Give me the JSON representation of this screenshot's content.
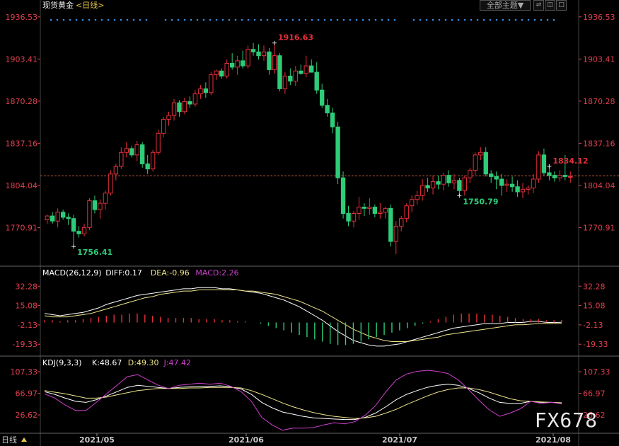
{
  "header": {
    "instrument": "现货黄金",
    "period_label": "<日线>"
  },
  "toolbar": {
    "theme_label": "全部主题",
    "theme_arrow": "▼",
    "btn_a": "⇌",
    "btn_b": "◫",
    "btn_c": "□"
  },
  "watermark": "FX678",
  "bottom_tag": "日线",
  "colors": {
    "up": "#e8303a",
    "down": "#2ecc78",
    "axis": "#e04050",
    "grid": "#444444",
    "ref": "#c0603c",
    "yellow": "#f0e68c",
    "white": "#ffffff",
    "magenta": "#d040d0",
    "dot": "#3a8ee6"
  },
  "chart_data": [
    {
      "type": "candlestick",
      "title": "现货黄金<日线>",
      "x_labels": [
        "2021/05",
        "2021/06",
        "2021/07",
        "2021/08"
      ],
      "y_ticks": [
        1936.53,
        1903.41,
        1870.28,
        1837.16,
        1804.04,
        1770.91
      ],
      "ylim": [
        1745,
        1942
      ],
      "last_price": 1811.5,
      "annotations": [
        {
          "label": "1756.41",
          "index": 5,
          "kind": "low"
        },
        {
          "label": "1916.63",
          "index": 43,
          "kind": "high"
        },
        {
          "label": "1750.79",
          "index": 78,
          "kind": "low"
        },
        {
          "label": "1834.12",
          "index": 95,
          "kind": "high"
        }
      ],
      "candles": [
        [
          1777,
          1781,
          1774,
          1780
        ],
        [
          1780,
          1783,
          1774,
          1776
        ],
        [
          1776,
          1786,
          1771,
          1783
        ],
        [
          1783,
          1785,
          1777,
          1779
        ],
        [
          1779,
          1782,
          1773,
          1778
        ],
        [
          1778,
          1781,
          1756,
          1768
        ],
        [
          1768,
          1772,
          1763,
          1766
        ],
        [
          1766,
          1774,
          1764,
          1771
        ],
        [
          1771,
          1794,
          1769,
          1792
        ],
        [
          1792,
          1796,
          1782,
          1785
        ],
        [
          1785,
          1793,
          1778,
          1790
        ],
        [
          1790,
          1800,
          1785,
          1798
        ],
        [
          1798,
          1816,
          1796,
          1813
        ],
        [
          1813,
          1821,
          1808,
          1819
        ],
        [
          1819,
          1834,
          1817,
          1830
        ],
        [
          1830,
          1838,
          1826,
          1833
        ],
        [
          1833,
          1835,
          1826,
          1828
        ],
        [
          1828,
          1839,
          1823,
          1836
        ],
        [
          1836,
          1838,
          1818,
          1821
        ],
        [
          1821,
          1828,
          1813,
          1817
        ],
        [
          1817,
          1832,
          1815,
          1830
        ],
        [
          1830,
          1848,
          1828,
          1845
        ],
        [
          1845,
          1858,
          1842,
          1856
        ],
        [
          1856,
          1862,
          1851,
          1859
        ],
        [
          1859,
          1872,
          1855,
          1869
        ],
        [
          1869,
          1871,
          1858,
          1862
        ],
        [
          1862,
          1873,
          1860,
          1870
        ],
        [
          1870,
          1874,
          1865,
          1868
        ],
        [
          1868,
          1879,
          1866,
          1876
        ],
        [
          1876,
          1883,
          1872,
          1880
        ],
        [
          1880,
          1885,
          1873,
          1877
        ],
        [
          1877,
          1893,
          1875,
          1891
        ],
        [
          1891,
          1895,
          1887,
          1894
        ],
        [
          1894,
          1896,
          1888,
          1890
        ],
        [
          1890,
          1903,
          1888,
          1900
        ],
        [
          1900,
          1908,
          1895,
          1897
        ],
        [
          1897,
          1906,
          1891,
          1902
        ],
        [
          1902,
          1910,
          1896,
          1898
        ],
        [
          1898,
          1914,
          1896,
          1911
        ],
        [
          1911,
          1916,
          1906,
          1909
        ],
        [
          1909,
          1915,
          1903,
          1906
        ],
        [
          1906,
          1914,
          1902,
          1909
        ],
        [
          1909,
          1912,
          1891,
          1895
        ],
        [
          1895,
          1916,
          1892,
          1906
        ],
        [
          1906,
          1908,
          1878,
          1880
        ],
        [
          1880,
          1893,
          1876,
          1890
        ],
        [
          1890,
          1896,
          1883,
          1886
        ],
        [
          1886,
          1898,
          1882,
          1894
        ],
        [
          1894,
          1899,
          1891,
          1892
        ],
        [
          1892,
          1906,
          1889,
          1898
        ],
        [
          1898,
          1903,
          1893,
          1893
        ],
        [
          1893,
          1901,
          1876,
          1879
        ],
        [
          1879,
          1884,
          1865,
          1867
        ],
        [
          1867,
          1872,
          1858,
          1861
        ],
        [
          1861,
          1865,
          1845,
          1850
        ],
        [
          1850,
          1854,
          1805,
          1810
        ],
        [
          1810,
          1815,
          1778,
          1782
        ],
        [
          1782,
          1788,
          1772,
          1776
        ],
        [
          1776,
          1784,
          1771,
          1782
        ],
        [
          1782,
          1795,
          1777,
          1787
        ],
        [
          1787,
          1790,
          1780,
          1786
        ],
        [
          1786,
          1794,
          1781,
          1787
        ],
        [
          1787,
          1789,
          1779,
          1782
        ],
        [
          1782,
          1790,
          1778,
          1783
        ],
        [
          1783,
          1787,
          1778,
          1786
        ],
        [
          1786,
          1789,
          1756,
          1760
        ],
        [
          1760,
          1776,
          1750,
          1772
        ],
        [
          1772,
          1780,
          1768,
          1778
        ],
        [
          1778,
          1790,
          1775,
          1788
        ],
        [
          1788,
          1796,
          1783,
          1793
        ],
        [
          1793,
          1800,
          1789,
          1796
        ],
        [
          1796,
          1809,
          1792,
          1804
        ],
        [
          1804,
          1810,
          1799,
          1802
        ],
        [
          1802,
          1812,
          1797,
          1807
        ],
        [
          1807,
          1812,
          1801,
          1805
        ],
        [
          1805,
          1814,
          1800,
          1812
        ],
        [
          1812,
          1816,
          1803,
          1806
        ],
        [
          1806,
          1813,
          1801,
          1808
        ],
        [
          1808,
          1810,
          1796,
          1800
        ],
        [
          1800,
          1812,
          1796,
          1810
        ],
        [
          1810,
          1818,
          1806,
          1816
        ],
        [
          1816,
          1830,
          1812,
          1828
        ],
        [
          1828,
          1834,
          1824,
          1830
        ],
        [
          1830,
          1834,
          1811,
          1813
        ],
        [
          1813,
          1816,
          1806,
          1811
        ],
        [
          1811,
          1815,
          1801,
          1809
        ],
        [
          1809,
          1813,
          1796,
          1804
        ],
        [
          1804,
          1809,
          1799,
          1805
        ],
        [
          1805,
          1811,
          1799,
          1803
        ],
        [
          1803,
          1808,
          1795,
          1799
        ],
        [
          1799,
          1806,
          1794,
          1801
        ],
        [
          1801,
          1804,
          1797,
          1802
        ],
        [
          1802,
          1813,
          1798,
          1809
        ],
        [
          1809,
          1831,
          1806,
          1828
        ],
        [
          1828,
          1833,
          1812,
          1814
        ],
        [
          1814,
          1819,
          1808,
          1812
        ],
        [
          1812,
          1815,
          1807,
          1810
        ],
        [
          1810,
          1816,
          1807,
          1812
        ],
        [
          1812,
          1828,
          1808,
          1811
        ],
        [
          1811,
          1815,
          1806,
          1811
        ]
      ]
    },
    {
      "type": "line",
      "title": "MACD(26,12,9)",
      "legend": [
        {
          "label": "MACD(26,12,9)",
          "key": "white"
        },
        {
          "label": "DIFF:0.17",
          "key": "white"
        },
        {
          "label": "DEA:-0.96",
          "key": "yellow"
        },
        {
          "label": "MACD:2.26",
          "key": "magenta"
        }
      ],
      "y_ticks": [
        32.28,
        15.08,
        -2.13,
        -19.33
      ],
      "ylim": [
        -28,
        40
      ],
      "series": [
        {
          "name": "DIFF",
          "color_key": "white",
          "values": [
            8,
            7,
            6,
            7,
            8,
            9,
            11,
            13,
            16,
            18,
            20,
            22,
            24,
            25,
            26,
            27,
            28,
            29,
            30,
            30,
            31,
            31,
            31,
            30,
            30,
            29,
            28,
            27,
            26,
            24,
            22,
            20,
            17,
            14,
            10,
            6,
            2,
            -3,
            -8,
            -12,
            -16,
            -18,
            -20,
            -21,
            -21,
            -20,
            -19,
            -17,
            -15,
            -13,
            -11,
            -9,
            -7,
            -5,
            -4,
            -3,
            -2,
            -1,
            -1,
            -1,
            0,
            0,
            0,
            1,
            1,
            0,
            0,
            0.17
          ]
        },
        {
          "name": "DEA",
          "color_key": "yellow",
          "values": [
            6,
            5,
            5,
            5,
            6,
            7,
            8,
            10,
            12,
            14,
            16,
            18,
            20,
            22,
            23,
            25,
            26,
            27,
            28,
            28,
            29,
            29,
            29,
            29,
            29,
            29,
            28,
            28,
            27,
            26,
            25,
            23,
            21,
            19,
            16,
            13,
            10,
            6,
            2,
            -2,
            -6,
            -9,
            -12,
            -14,
            -16,
            -17,
            -17,
            -17,
            -16,
            -15,
            -14,
            -13,
            -11,
            -10,
            -9,
            -8,
            -7,
            -6,
            -5,
            -4,
            -3,
            -2,
            -2,
            -1.5,
            -1,
            -1,
            -1,
            -0.96
          ]
        },
        {
          "name": "MACD",
          "color_key": "magenta",
          "values": [
            2,
            2,
            1,
            2,
            2,
            3,
            4,
            5,
            6,
            7,
            7,
            8,
            8,
            7,
            6,
            5,
            4,
            4,
            4,
            4,
            3,
            3,
            3,
            2,
            2,
            1,
            1,
            0,
            -1,
            -3,
            -5,
            -7,
            -9,
            -11,
            -13,
            -15,
            -17,
            -19,
            -20,
            -20,
            -19,
            -17,
            -15,
            -13,
            -11,
            -9,
            -7,
            -5,
            -3,
            -1,
            1,
            3,
            5,
            7,
            8,
            8,
            8,
            7,
            7,
            6,
            5,
            4,
            3,
            3,
            3,
            2,
            2,
            2.26
          ]
        }
      ]
    },
    {
      "type": "line",
      "title": "KDJ(9,3,3)",
      "legend": [
        {
          "label": "KDJ(9,3,3)",
          "key": "white"
        },
        {
          "label": "K:48.67",
          "key": "white"
        },
        {
          "label": "D:49.30",
          "key": "yellow"
        },
        {
          "label": "J:47.42",
          "key": "magenta"
        }
      ],
      "y_ticks": [
        107.33,
        66.97,
        26.62
      ],
      "ylim": [
        -5,
        118
      ],
      "series": [
        {
          "name": "K",
          "color_key": "white",
          "values": [
            70,
            65,
            58,
            52,
            50,
            55,
            62,
            70,
            78,
            82,
            80,
            78,
            76,
            78,
            79,
            80,
            80,
            81,
            79,
            75,
            65,
            50,
            40,
            32,
            28,
            24,
            21,
            20,
            19,
            18,
            18,
            22,
            30,
            42,
            55,
            65,
            72,
            78,
            82,
            84,
            82,
            76,
            68,
            58,
            50,
            48,
            48,
            52,
            50,
            50,
            48.67
          ]
        },
        {
          "name": "D",
          "color_key": "yellow",
          "values": [
            72,
            69,
            66,
            62,
            58,
            58,
            60,
            64,
            68,
            72,
            74,
            76,
            76,
            76,
            77,
            77,
            78,
            78,
            78,
            77,
            72,
            65,
            57,
            49,
            42,
            36,
            31,
            27,
            24,
            22,
            20,
            21,
            24,
            30,
            37,
            46,
            54,
            62,
            69,
            74,
            77,
            77,
            74,
            69,
            63,
            57,
            53,
            52,
            51,
            50,
            49.3
          ]
        },
        {
          "name": "J",
          "color_key": "magenta",
          "values": [
            66,
            58,
            45,
            35,
            35,
            50,
            66,
            82,
            98,
            102,
            92,
            82,
            76,
            82,
            84,
            86,
            84,
            86,
            80,
            70,
            52,
            22,
            8,
            -2,
            2,
            2,
            3,
            8,
            12,
            10,
            14,
            26,
            44,
            70,
            92,
            103,
            108,
            110,
            108,
            104,
            92,
            74,
            54,
            36,
            24,
            30,
            38,
            52,
            48,
            50,
            47.42
          ]
        }
      ]
    }
  ]
}
